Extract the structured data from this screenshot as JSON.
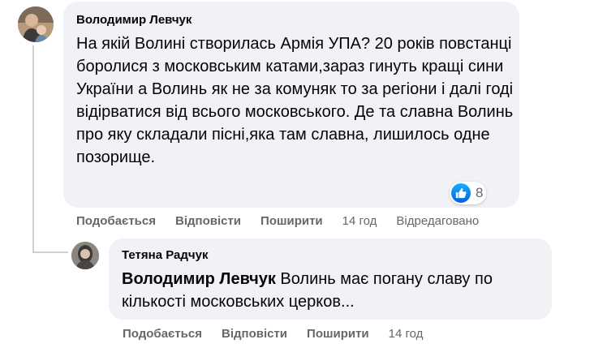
{
  "comments": [
    {
      "author": "Володимир Левчук",
      "avatar_icon": "user-avatar-icon",
      "text": "На якій Волині створилась Армія УПА? 20 років повстанці боролися з московським катами,зараз гинуть кращі сини України а Волинь як не за комуняк то за регіони і далі годі відірватися від всього московського. Де та славна Волинь про яку складали пісні,яка там славна, лишилось одне позорище.",
      "reaction": {
        "icon": "like-icon",
        "count": "8"
      },
      "actions": {
        "like": "Подобається",
        "reply": "Відповісти",
        "share": "Поширити",
        "time": "14 год",
        "edited": "Відредаговано"
      }
    }
  ],
  "reply": {
    "author": "Тетяна Радчук",
    "avatar_icon": "user-avatar-icon",
    "mention": "Володимир Левчук",
    "text": " Волинь має погану славу по кількості московських церков...",
    "actions": {
      "like": "Подобається",
      "reply": "Відповісти",
      "share": "Поширити",
      "time": "14 год"
    }
  },
  "colors": {
    "bubble": "#f0f2f5",
    "secondary_text": "#65676b",
    "like_blue": "#0866ff"
  }
}
